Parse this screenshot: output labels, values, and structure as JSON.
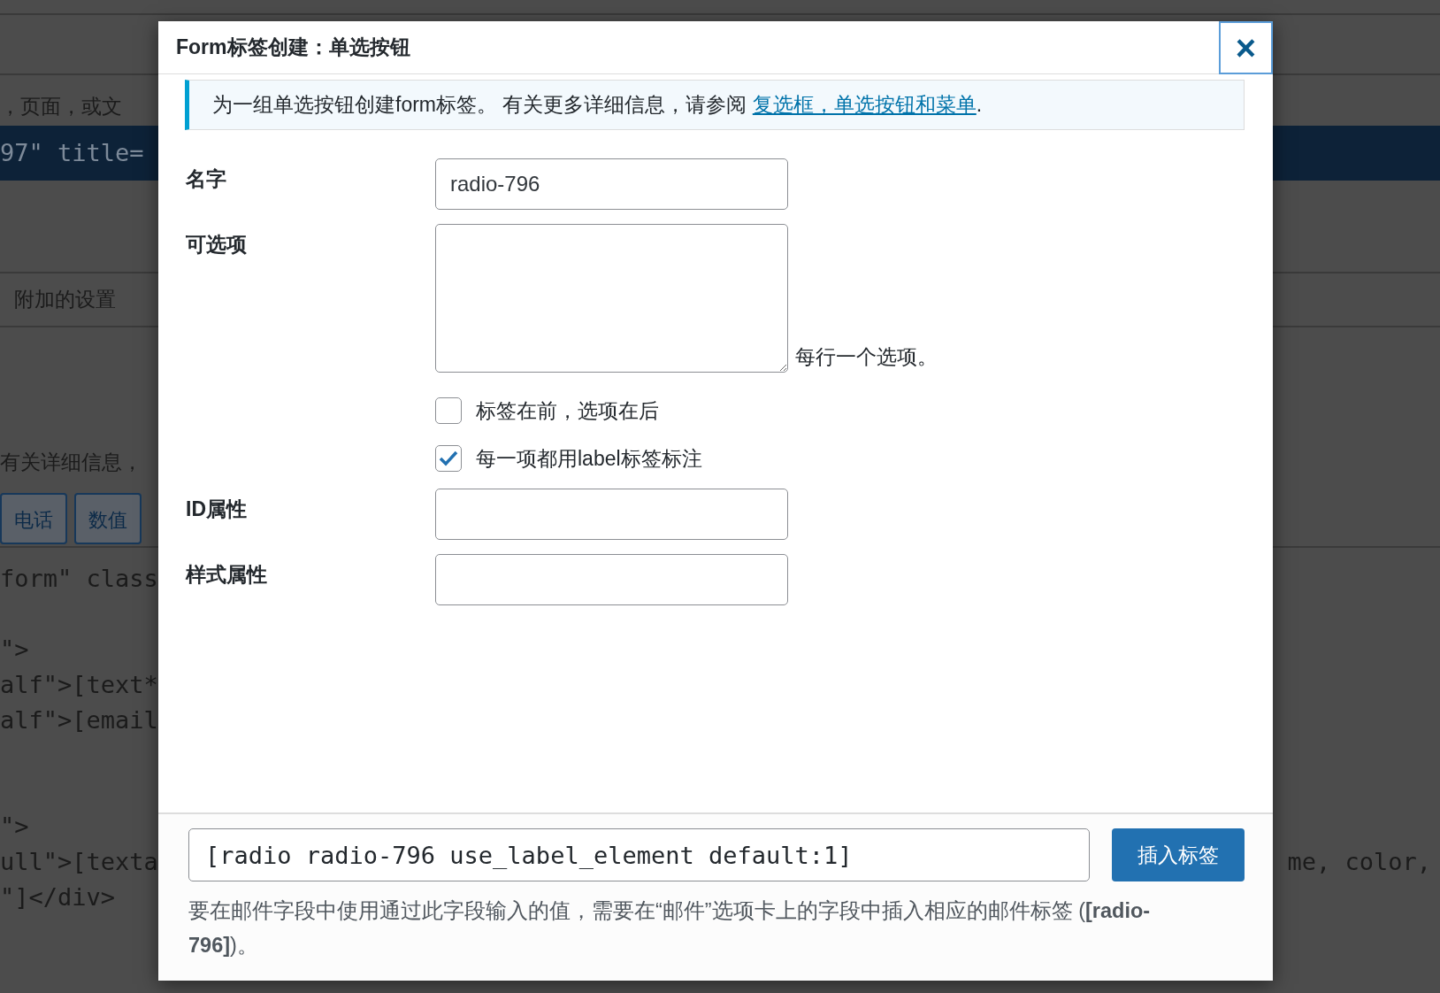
{
  "background": {
    "lines": [
      {
        "kind": "text",
        "text": "，页面，或文"
      },
      {
        "kind": "code_bar",
        "text": "97\" title="
      },
      {
        "kind": "tab",
        "text": "附加的设置"
      },
      {
        "kind": "text",
        "text": "有关详细信息，"
      },
      {
        "kind": "buttons",
        "labels": [
          "电话",
          "数值"
        ]
      },
      {
        "kind": "code",
        "text": "form\" class"
      },
      {
        "kind": "code",
        "text": "\">"
      },
      {
        "kind": "code",
        "text": "alf\">[text*"
      },
      {
        "kind": "code",
        "text": "alf\">[email"
      },
      {
        "kind": "code",
        "text": "\">"
      },
      {
        "kind": "code",
        "text": "ull\">[texta",
        "right": "me, color,"
      },
      {
        "kind": "code",
        "text": "\"]</div>"
      }
    ]
  },
  "dialog": {
    "title": "Form标签创建：单选按钮",
    "close": "×",
    "notice": {
      "text": "为一组单选按钮创建form标签。 有关更多详细信息，请参阅",
      "link": "复选框，单选按钮和菜单",
      "after": "."
    },
    "fields": [
      {
        "kind": "text",
        "label": "名字",
        "value": "radio-796"
      },
      {
        "kind": "textarea",
        "label": "可选项",
        "note": "每行一个选项。",
        "options": [
          {
            "label": "标签在前，选项在后",
            "checked": false
          },
          {
            "label": "每一项都用label标签标注",
            "checked": true
          }
        ]
      },
      {
        "kind": "text",
        "label": "ID属性"
      },
      {
        "kind": "text",
        "label": "样式属性"
      }
    ],
    "tag": "[radio radio-796 use_label_element default:1]",
    "insert_button": "插入标签",
    "hint": "要在邮件字段中使用通过此字段输入的值，需要在“邮件”选项卡上的字段中插入相应的邮件标签 (**[radio-796]**)。"
  }
}
